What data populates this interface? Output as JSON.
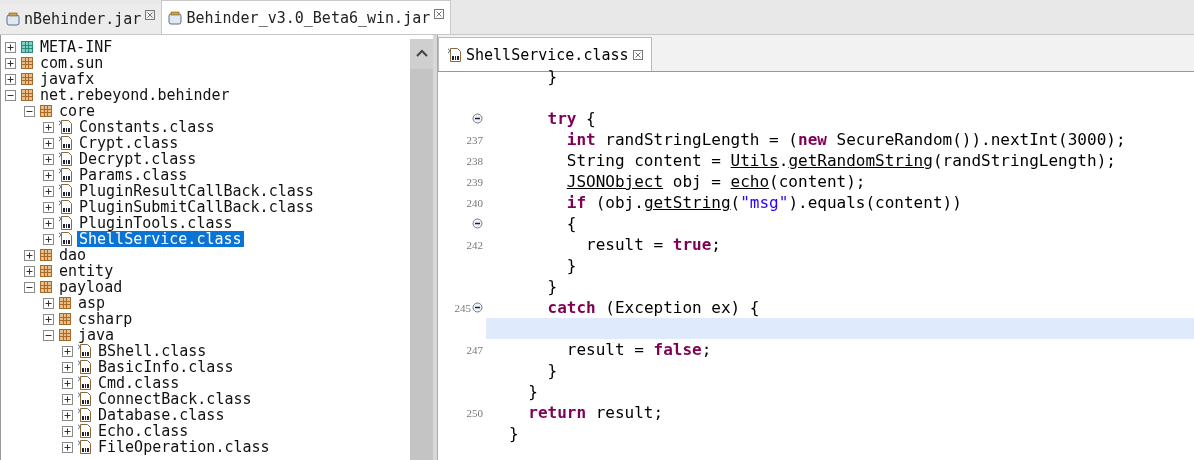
{
  "tabs": [
    {
      "label": "nBehinder.jar",
      "selected": false
    },
    {
      "label": "Behinder_v3.0_Beta6_win.jar",
      "selected": true
    }
  ],
  "tree": [
    {
      "label": "META-INF",
      "kind": "folder",
      "expanded": false,
      "selected": false
    },
    {
      "label": "com.sun",
      "kind": "package",
      "expanded": false,
      "selected": false
    },
    {
      "label": "javafx",
      "kind": "package",
      "expanded": false,
      "selected": false
    },
    {
      "label": "net.rebeyond.behinder",
      "kind": "package",
      "expanded": true,
      "selected": false,
      "children": [
        {
          "label": "core",
          "kind": "package",
          "expanded": true,
          "selected": false,
          "children": [
            {
              "label": "Constants.class",
              "kind": "class",
              "expanded": false,
              "selected": false
            },
            {
              "label": "Crypt.class",
              "kind": "class",
              "expanded": false,
              "selected": false
            },
            {
              "label": "Decrypt.class",
              "kind": "class",
              "expanded": false,
              "selected": false
            },
            {
              "label": "Params.class",
              "kind": "class",
              "expanded": false,
              "selected": false
            },
            {
              "label": "PluginResultCallBack.class",
              "kind": "class",
              "expanded": false,
              "selected": false
            },
            {
              "label": "PluginSubmitCallBack.class",
              "kind": "class",
              "expanded": false,
              "selected": false
            },
            {
              "label": "PluginTools.class",
              "kind": "class",
              "expanded": false,
              "selected": false
            },
            {
              "label": "ShellService.class",
              "kind": "class",
              "expanded": false,
              "selected": true
            }
          ]
        },
        {
          "label": "dao",
          "kind": "package",
          "expanded": false,
          "selected": false
        },
        {
          "label": "entity",
          "kind": "package",
          "expanded": false,
          "selected": false
        },
        {
          "label": "payload",
          "kind": "package",
          "expanded": true,
          "selected": false,
          "children": [
            {
              "label": "asp",
              "kind": "package",
              "expanded": false,
              "selected": false
            },
            {
              "label": "csharp",
              "kind": "package",
              "expanded": false,
              "selected": false
            },
            {
              "label": "java",
              "kind": "package",
              "expanded": true,
              "selected": false,
              "children": [
                {
                  "label": "BShell.class",
                  "kind": "class",
                  "expanded": false,
                  "selected": false
                },
                {
                  "label": "BasicInfo.class",
                  "kind": "class",
                  "expanded": false,
                  "selected": false
                },
                {
                  "label": "Cmd.class",
                  "kind": "class",
                  "expanded": false,
                  "selected": false
                },
                {
                  "label": "ConnectBack.class",
                  "kind": "class",
                  "expanded": false,
                  "selected": false
                },
                {
                  "label": "Database.class",
                  "kind": "class",
                  "expanded": false,
                  "selected": false
                },
                {
                  "label": "Echo.class",
                  "kind": "class",
                  "expanded": false,
                  "selected": false
                },
                {
                  "label": "FileOperation.class",
                  "kind": "class",
                  "expanded": false,
                  "selected": false
                }
              ]
            }
          ]
        }
      ]
    }
  ],
  "editor": {
    "tab": {
      "label": "ShellService.class",
      "selected": true
    },
    "lines": [
      {
        "fold": false,
        "highlighted": false,
        "tokens": [
          {
            "kind": "plain",
            "text": "    }"
          }
        ]
      },
      {
        "fold": false,
        "highlighted": false
      },
      {
        "fold": true,
        "highlighted": false,
        "tokens": [
          {
            "kind": "keyword",
            "text": "    try"
          },
          {
            "kind": "plain",
            "text": " {"
          }
        ]
      },
      {
        "number": "237",
        "fold": false,
        "highlighted": false,
        "tokens": [
          {
            "kind": "keyword",
            "text": "      int"
          },
          {
            "kind": "plain",
            "text": " randStringLength = ("
          },
          {
            "kind": "keyword",
            "text": "new"
          },
          {
            "kind": "plain",
            "text": " SecureRandom()).nextInt(3000);"
          }
        ]
      },
      {
        "number": "238",
        "fold": false,
        "highlighted": false,
        "tokens": [
          {
            "kind": "plain",
            "text": "      String content = "
          },
          {
            "kind": "link",
            "text": "Utils"
          },
          {
            "kind": "plain",
            "text": "."
          },
          {
            "kind": "link",
            "text": "getRandomString"
          },
          {
            "kind": "plain",
            "text": "(randStringLength);"
          }
        ]
      },
      {
        "number": "239",
        "fold": false,
        "highlighted": false,
        "tokens": [
          {
            "kind": "link",
            "text": "      JSONObject"
          },
          {
            "kind": "plain",
            "text": " obj = "
          },
          {
            "kind": "link",
            "text": "echo"
          },
          {
            "kind": "plain",
            "text": "(content);"
          }
        ]
      },
      {
        "number": "240",
        "fold": false,
        "highlighted": false,
        "tokens": [
          {
            "kind": "keyword",
            "text": "      if"
          },
          {
            "kind": "plain",
            "text": " (obj."
          },
          {
            "kind": "link",
            "text": "getString"
          },
          {
            "kind": "plain",
            "text": "("
          },
          {
            "kind": "string",
            "text": "\"msg\""
          },
          {
            "kind": "plain",
            "text": ").equals(content))"
          }
        ]
      },
      {
        "fold": true,
        "highlighted": false,
        "tokens": [
          {
            "kind": "plain",
            "text": "      {"
          }
        ]
      },
      {
        "number": "242",
        "fold": false,
        "highlighted": false,
        "tokens": [
          {
            "kind": "plain",
            "text": "        result = "
          },
          {
            "kind": "keyword",
            "text": "true"
          },
          {
            "kind": "plain",
            "text": ";"
          }
        ]
      },
      {
        "fold": false,
        "highlighted": false,
        "tokens": [
          {
            "kind": "plain",
            "text": "      }"
          }
        ]
      },
      {
        "fold": false,
        "highlighted": false,
        "tokens": [
          {
            "kind": "plain",
            "text": "    }"
          }
        ]
      },
      {
        "number": "245",
        "fold": true,
        "highlighted": false,
        "tokens": [
          {
            "kind": "keyword",
            "text": "    catch"
          },
          {
            "kind": "plain",
            "text": " (Exception ex) {"
          }
        ]
      },
      {
        "fold": false,
        "highlighted": true
      },
      {
        "number": "247",
        "fold": false,
        "highlighted": false,
        "tokens": [
          {
            "kind": "plain",
            "text": "      result = "
          },
          {
            "kind": "keyword",
            "text": "false"
          },
          {
            "kind": "plain",
            "text": ";"
          }
        ]
      },
      {
        "fold": false,
        "highlighted": false,
        "tokens": [
          {
            "kind": "plain",
            "text": "    }"
          }
        ]
      },
      {
        "fold": false,
        "highlighted": false,
        "tokens": [
          {
            "kind": "plain",
            "text": "  }"
          }
        ]
      },
      {
        "number": "250",
        "fold": false,
        "highlighted": false,
        "tokens": [
          {
            "kind": "keyword",
            "text": "  return"
          },
          {
            "kind": "plain",
            "text": " result;"
          }
        ]
      },
      {
        "fold": false,
        "highlighted": false,
        "tokens": [
          {
            "kind": "plain",
            "text": "}"
          }
        ]
      }
    ]
  }
}
